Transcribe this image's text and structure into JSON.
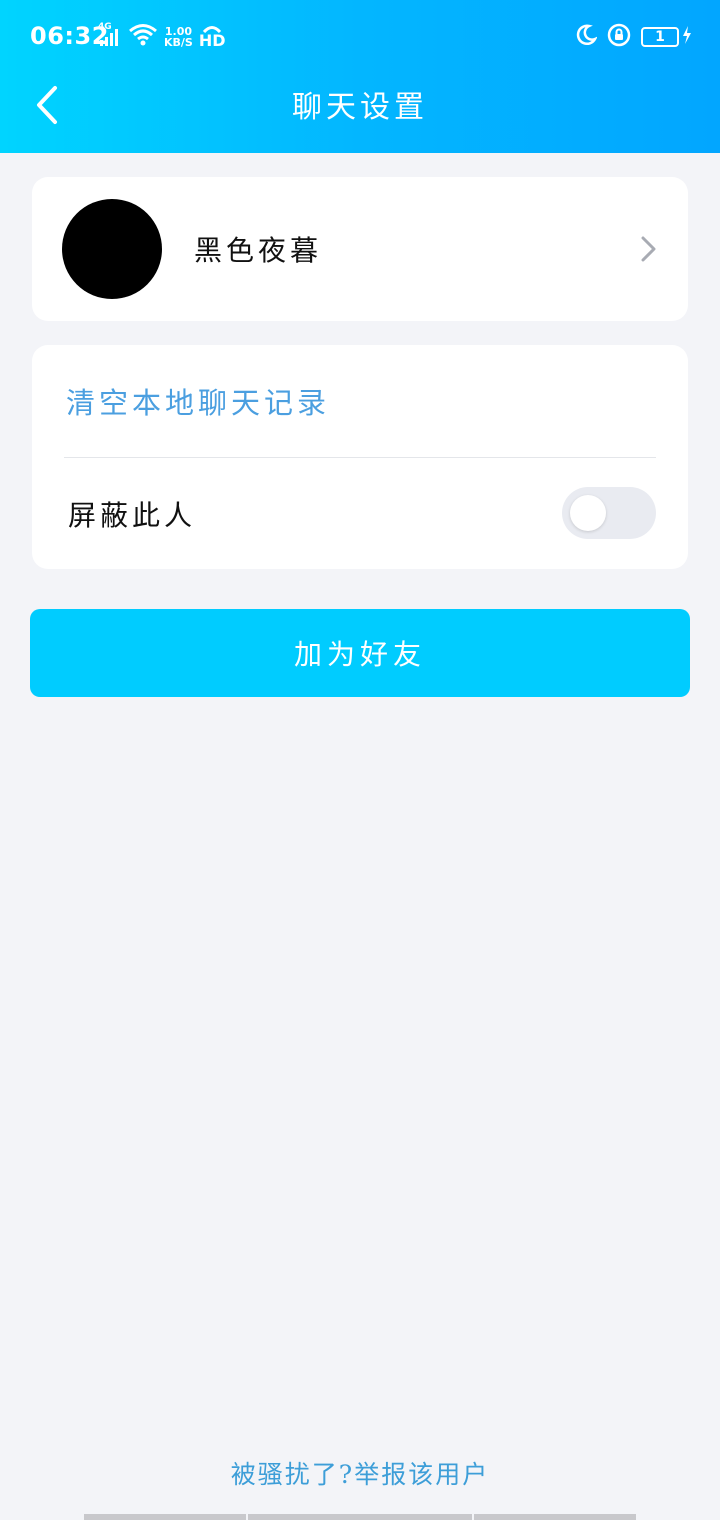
{
  "status_bar": {
    "time": "06:32",
    "network_type": "4G",
    "speed_value": "1.00",
    "speed_unit": "KB/S",
    "hd_label": "HD",
    "battery_level": "1",
    "icons": [
      "signal-icon",
      "wifi-icon",
      "moon-icon",
      "rotation-lock-icon",
      "battery-icon",
      "charging-icon"
    ]
  },
  "navbar": {
    "title": "聊天设置",
    "back_icon": "back-arrow-icon"
  },
  "profile": {
    "name": "黑色夜暮",
    "avatar_color": "#000000"
  },
  "settings": {
    "clear_history_label": "清空本地聊天记录",
    "block_user_label": "屏蔽此人",
    "block_user_enabled": false
  },
  "actions": {
    "add_friend_label": "加为好友",
    "report_label": "被骚扰了?举报该用户"
  },
  "colors": {
    "header_gradient_start": "#00d4ff",
    "header_gradient_end": "#02a6ff",
    "button_bg": "#00ccff",
    "link_blue": "#4b9fe0",
    "page_bg": "#f3f4f8"
  }
}
